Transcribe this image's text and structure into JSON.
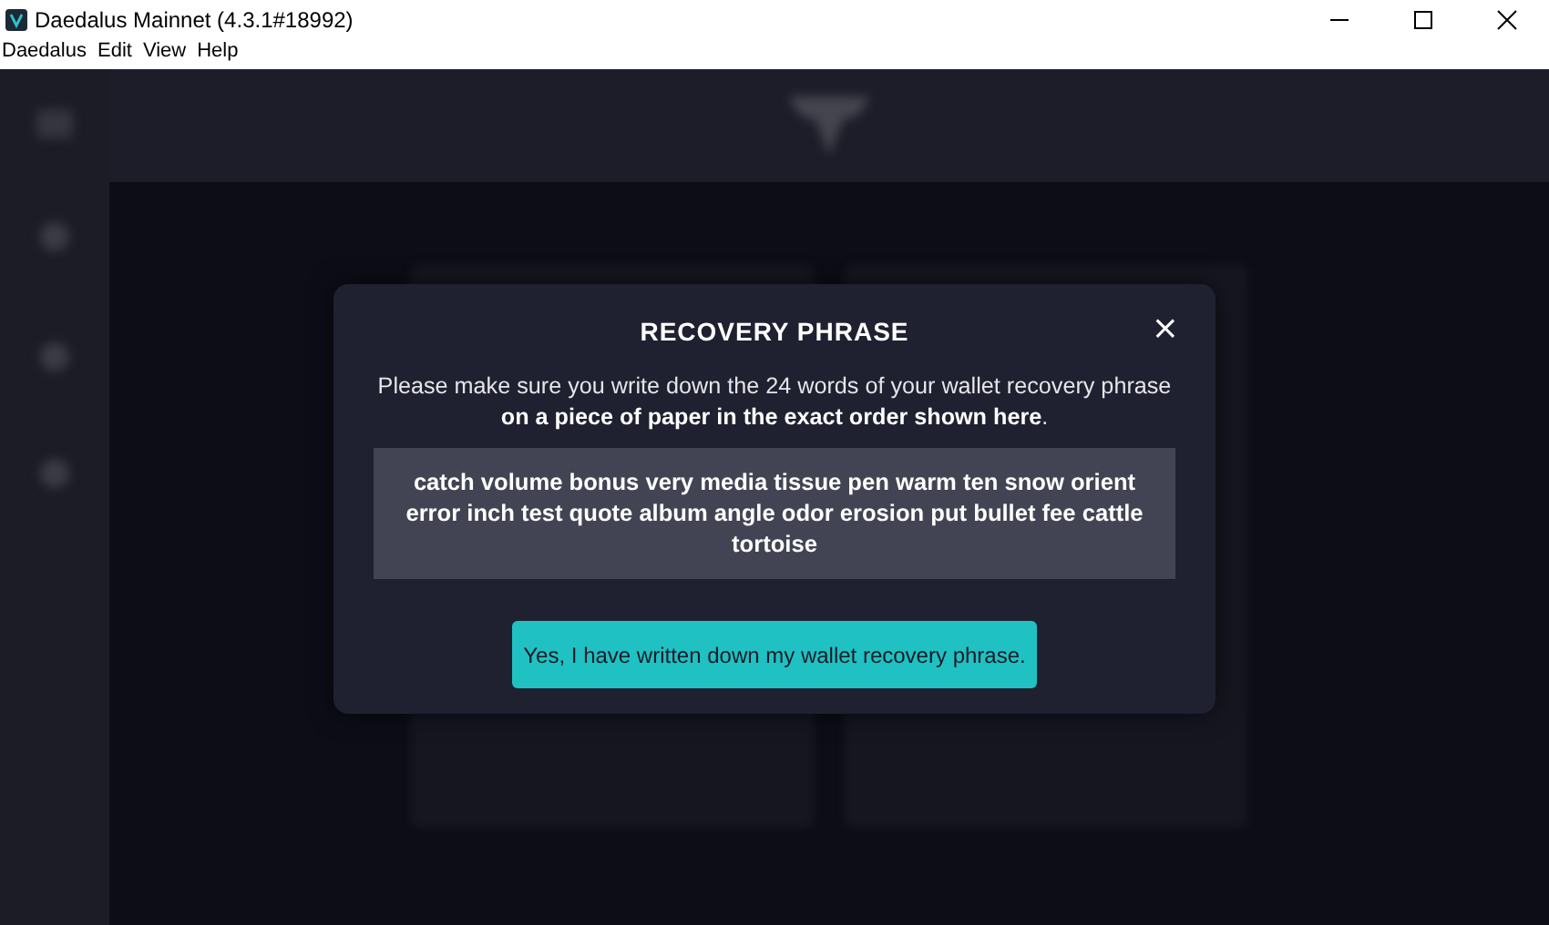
{
  "window": {
    "title": "Daedalus Mainnet (4.3.1#18992)"
  },
  "menu": [
    "Daedalus",
    "Edit",
    "View",
    "Help"
  ],
  "dialog": {
    "title": "RECOVERY PHRASE",
    "close": "×",
    "instructions": "Please make sure you write down the 24 words of your wallet recovery phrase **on a piece of paper in the exact order shown here**.",
    "phrase": "catch volume bonus very media tissue pen warm ten snow orient error inch test quote album angle odor erosion put bullet fee cattle tortoise",
    "confirm_button": "Yes, I have written down my wallet recovery phrase."
  }
}
